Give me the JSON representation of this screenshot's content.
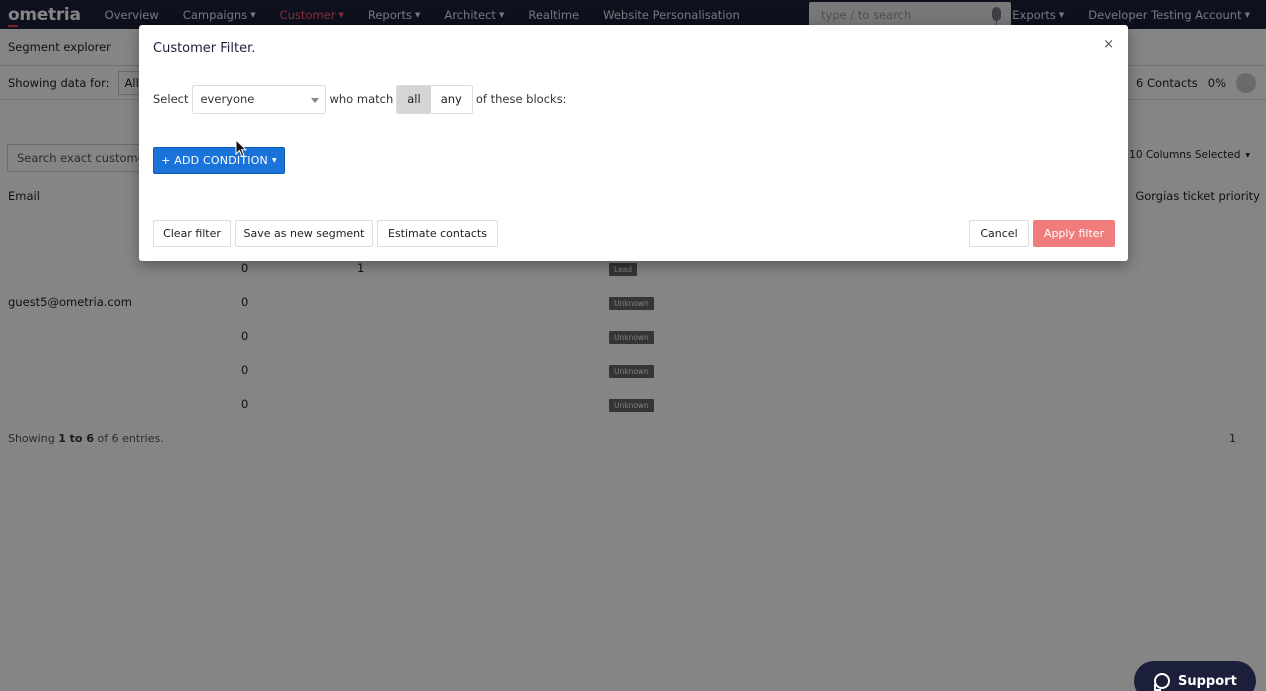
{
  "nav": {
    "logo": "ometria",
    "items": [
      {
        "label": "Overview",
        "dropdown": false
      },
      {
        "label": "Campaigns",
        "dropdown": true
      },
      {
        "label": "Customer",
        "dropdown": true,
        "active": true
      },
      {
        "label": "Reports",
        "dropdown": true
      },
      {
        "label": "Architect",
        "dropdown": true
      },
      {
        "label": "Realtime",
        "dropdown": false
      },
      {
        "label": "Website Personalisation",
        "dropdown": false
      }
    ],
    "search_placeholder": "type / to search",
    "exports_label": "Exports",
    "account_label": "Developer Testing Account",
    "active_color": "#ff5a66"
  },
  "page": {
    "subtitle": "Segment explorer",
    "showing_data_for": "Showing data for:",
    "all_label": "All co",
    "contacts_count": "6 Contacts",
    "contacts_percent": "0%",
    "search_placeholder": "Search exact customer",
    "columns_selected": "10 Columns Selected",
    "col_email": "Email",
    "col_gorgias": "Gorgias ticket priority",
    "rows": [
      {
        "email": "",
        "num": "0",
        "badge": "Lead",
        "extra": "1"
      },
      {
        "email": "guest5@ometria.com",
        "num": "0",
        "badge": "Unknown"
      },
      {
        "email": "",
        "num": "0",
        "badge": "Unknown"
      },
      {
        "email": "",
        "num": "0",
        "badge": "Unknown"
      },
      {
        "email": "",
        "num": "0",
        "badge": "Unknown"
      }
    ],
    "showing_prefix": "Showing ",
    "showing_range": "1 to 6",
    "showing_suffix": " of 6 entries.",
    "pager": "1"
  },
  "modal": {
    "title": "Customer Filter.",
    "close": "×",
    "select_label": "Select",
    "select_value": "everyone",
    "who_match": "who match",
    "toggle_all": "all",
    "toggle_any": "any",
    "of_blocks": "of these blocks:",
    "add_condition": "+ ADD CONDITION",
    "clear_filter": "Clear filter",
    "save_segment": "Save as new segment",
    "estimate": "Estimate contacts",
    "cancel": "Cancel",
    "apply": "Apply filter",
    "primary_color": "#1a73d9",
    "apply_color": "#f07c7c"
  },
  "support": {
    "label": "Support"
  }
}
